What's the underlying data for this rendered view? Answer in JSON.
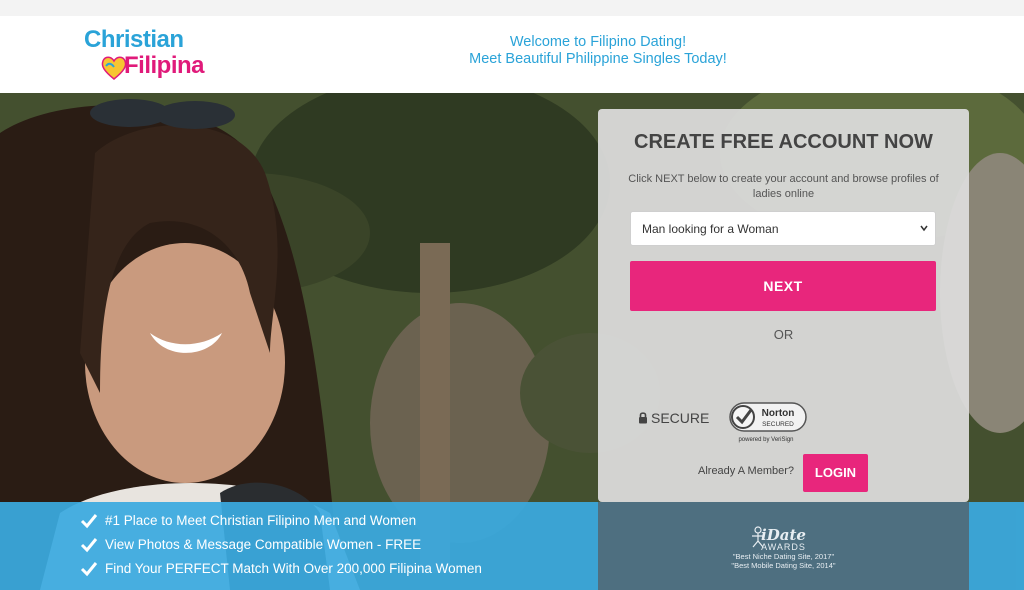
{
  "header": {
    "logo_line1": "Christian",
    "logo_line2": "Filipina",
    "welcome_line1": "Welcome to Filipino Dating!",
    "welcome_line2": "Meet Beautiful Philippine Singles Today!"
  },
  "signup": {
    "title": "CREATE FREE ACCOUNT NOW",
    "subtitle": "Click NEXT below to create your account and browse profiles of ladies online",
    "select_value": "Man looking for a Woman",
    "next_label": "NEXT",
    "or_label": "OR",
    "secure_label": "SECURE",
    "norton_line1": "Norton",
    "norton_line2": "SECURED",
    "norton_line3": "powered by VeriSign",
    "member_label": "Already A Member?",
    "login_label": "LOGIN"
  },
  "features": [
    "#1 Place to Meet Christian Filipino Men and Women",
    "View Photos & Message Compatible Women - FREE",
    "Find Your PERFECT Match With Over 200,000 Filipina Women"
  ],
  "award": {
    "line1": "iDate",
    "line2": "AWARDS",
    "quote1": "\"Best Niche Dating Site, 2017\"",
    "quote2": "\"Best Mobile Dating Site, 2014\""
  },
  "colors": {
    "brand_blue": "#2aa3d8",
    "brand_pink": "#e8267c",
    "award_panel": "#4e6f80"
  },
  "icons": [
    "heart-logo-icon",
    "chevron-down-icon",
    "lock-icon",
    "norton-check-icon",
    "checkmark-icon",
    "award-figure-icon"
  ]
}
